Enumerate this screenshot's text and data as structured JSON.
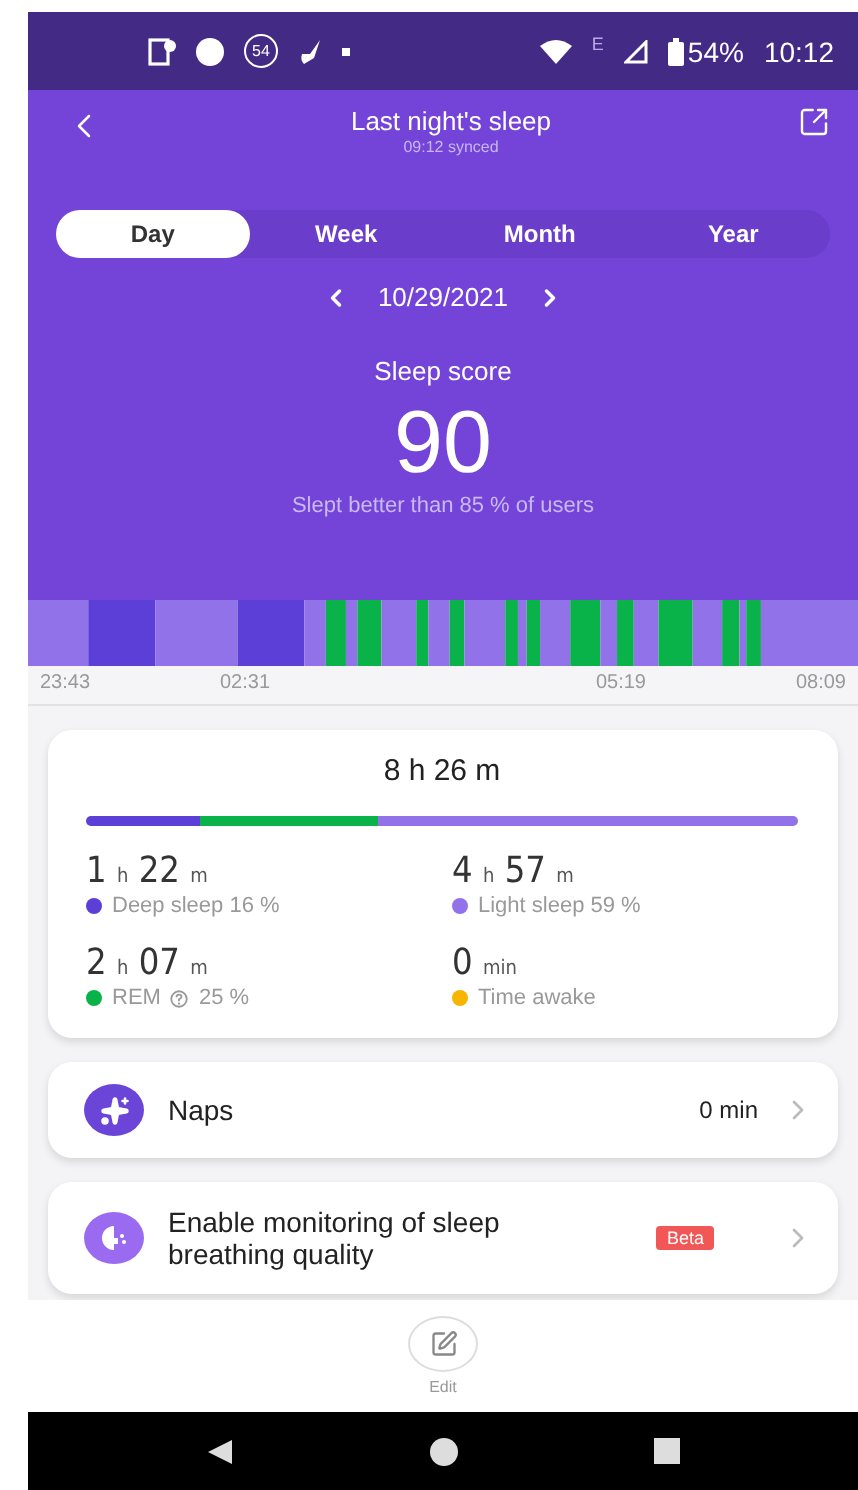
{
  "status_bar": {
    "notification_count": "54",
    "network": "E",
    "battery": "54%",
    "time": "10:12"
  },
  "header": {
    "title": "Last night's sleep",
    "subtitle": "09:12 synced"
  },
  "tabs": [
    {
      "label": "Day",
      "selected": true
    },
    {
      "label": "Week",
      "selected": false
    },
    {
      "label": "Month",
      "selected": false
    },
    {
      "label": "Year",
      "selected": false
    }
  ],
  "date": "10/29/2021",
  "score": {
    "label": "Sleep score",
    "value": "90",
    "comparison": "Slept better than 85 % of users"
  },
  "timeline": {
    "times": [
      "23:43",
      "02:31",
      "05:19",
      "08:09"
    ]
  },
  "summary": {
    "total": "8 h 26 m",
    "stages": [
      {
        "parts": [
          {
            "number": "1",
            "unit": "h"
          },
          {
            "number": "22",
            "unit": "m"
          }
        ],
        "label": "Deep sleep 16 %",
        "color": "#5b3fd6"
      },
      {
        "parts": [
          {
            "number": "4",
            "unit": "h"
          },
          {
            "number": "57",
            "unit": "m"
          }
        ],
        "label": "Light sleep 59 %",
        "color": "#9272e8"
      },
      {
        "parts": [
          {
            "number": "2",
            "unit": "h"
          },
          {
            "number": "07",
            "unit": "m"
          }
        ],
        "label": "REM",
        "percent": "25 %",
        "color": "#0ab34a"
      },
      {
        "parts": [
          {
            "number": "0",
            "unit": "min"
          }
        ],
        "label": "Time awake",
        "color": "#f7b500"
      }
    ]
  },
  "naps": {
    "label": "Naps",
    "value": "0 min"
  },
  "breathing": {
    "label": "Enable monitoring of sleep breathing quality",
    "badge": "Beta"
  },
  "edit": {
    "label": "Edit"
  }
}
